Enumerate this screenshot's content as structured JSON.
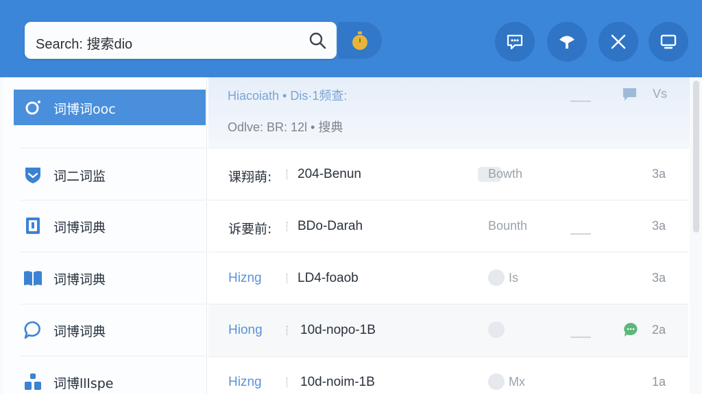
{
  "header": {
    "search_text": "Search: 搜索dio",
    "buttons": [
      {
        "name": "stopwatch",
        "icon": "stopwatch-icon"
      },
      {
        "name": "feedback",
        "icon": "chat-icon"
      },
      {
        "name": "tips",
        "icon": "lightbulb-icon"
      },
      {
        "name": "close",
        "icon": "close-icon"
      },
      {
        "name": "display",
        "icon": "monitor-icon"
      }
    ]
  },
  "sidebar": {
    "items": [
      {
        "label": "词博词ooc",
        "icon": "shield-icon",
        "active": true
      },
      {
        "label": "词二词监",
        "icon": "shield-icon"
      },
      {
        "label": "词博词典",
        "icon": "book-icon"
      },
      {
        "label": "词博词典",
        "icon": "open-book-icon"
      },
      {
        "label": "词博词典",
        "icon": "chat-bubble-icon"
      },
      {
        "label": "词博lllspe",
        "icon": "people-icon"
      }
    ]
  },
  "main": {
    "header_line1": "Hiacoiath • Dis·1频查:",
    "header_line2": "Odlve: BR: 12l • 搜典",
    "header_right": "Vs",
    "rows": [
      {
        "col_a": "课翔萌:",
        "col_b": "204-Benun",
        "col_c": "Bowth",
        "col_d": "3a"
      },
      {
        "col_a": "诉要前:",
        "col_b": "BDo-Darah",
        "col_c": "Bounth",
        "col_d": "3a"
      },
      {
        "col_a": "Hizng",
        "col_b": "LD4-foaob",
        "col_c": "Is",
        "col_d": "3a"
      },
      {
        "col_a": "Hiong",
        "col_b": "10d-nopo-1B",
        "col_c": "",
        "col_d": "2a"
      },
      {
        "col_a": "Hizng",
        "col_b": "10d-noim-1B",
        "col_c": "Mx",
        "col_d": "1a"
      }
    ]
  },
  "colors": {
    "header_bg": "#3c86d9",
    "active_item": "#4a8fdc",
    "accent_green": "#5cb879",
    "timer": "#e8b43a"
  }
}
